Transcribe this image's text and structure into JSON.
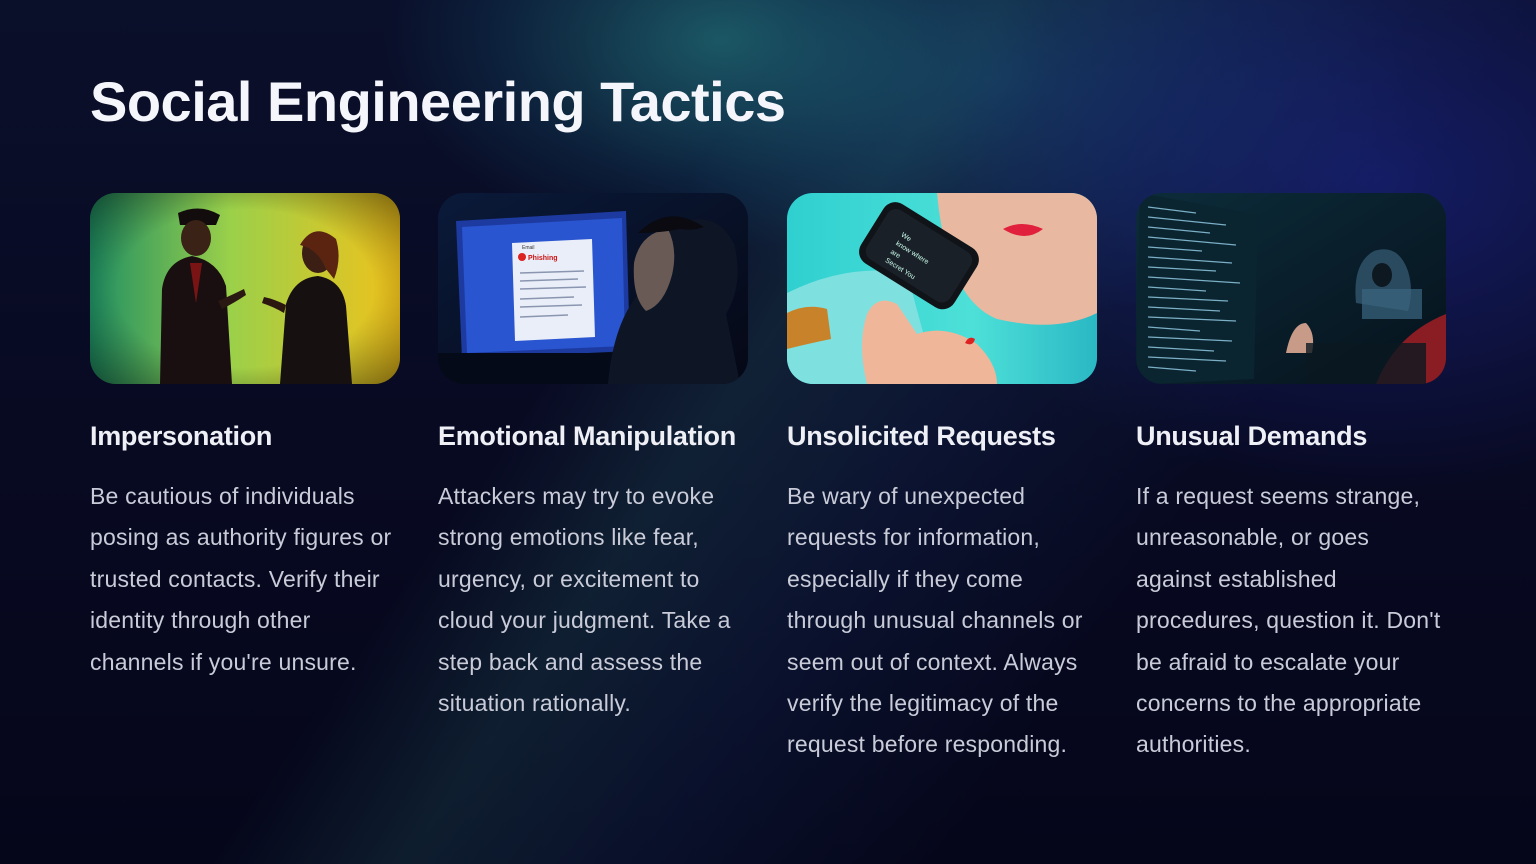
{
  "slide": {
    "title": "Social Engineering Tactics"
  },
  "cards": [
    {
      "heading": "Impersonation",
      "body": "Be cautious of individuals posing as authority figures or trusted contacts. Verify their identity through other channels if you're unsure.",
      "image_icon": "two-people-arguing-image"
    },
    {
      "heading": "Emotional Manipulation",
      "body": "Attackers may try to evoke strong emotions like fear, urgency, or excitement to cloud your judgment. Take a step back and assess the situation rationally.",
      "image_icon": "phishing-email-screen-image",
      "screen_text": {
        "app": "Email",
        "headline": "Phishing"
      }
    },
    {
      "heading": "Unsolicited Requests",
      "body": "Be wary of unexpected requests for information, especially if they come through unusual channels or seem out of context. Always verify the legitimacy of the request before responding.",
      "image_icon": "hand-holding-phone-image",
      "phone_text": [
        "We",
        "know where",
        "are",
        "Secret You"
      ]
    },
    {
      "heading": "Unusual Demands",
      "body": "If a request seems strange, unreasonable, or goes against established procedures, question it. Don't be afraid to escalate your concerns to the appropriate authorities.",
      "image_icon": "hacker-code-screen-image"
    }
  ]
}
